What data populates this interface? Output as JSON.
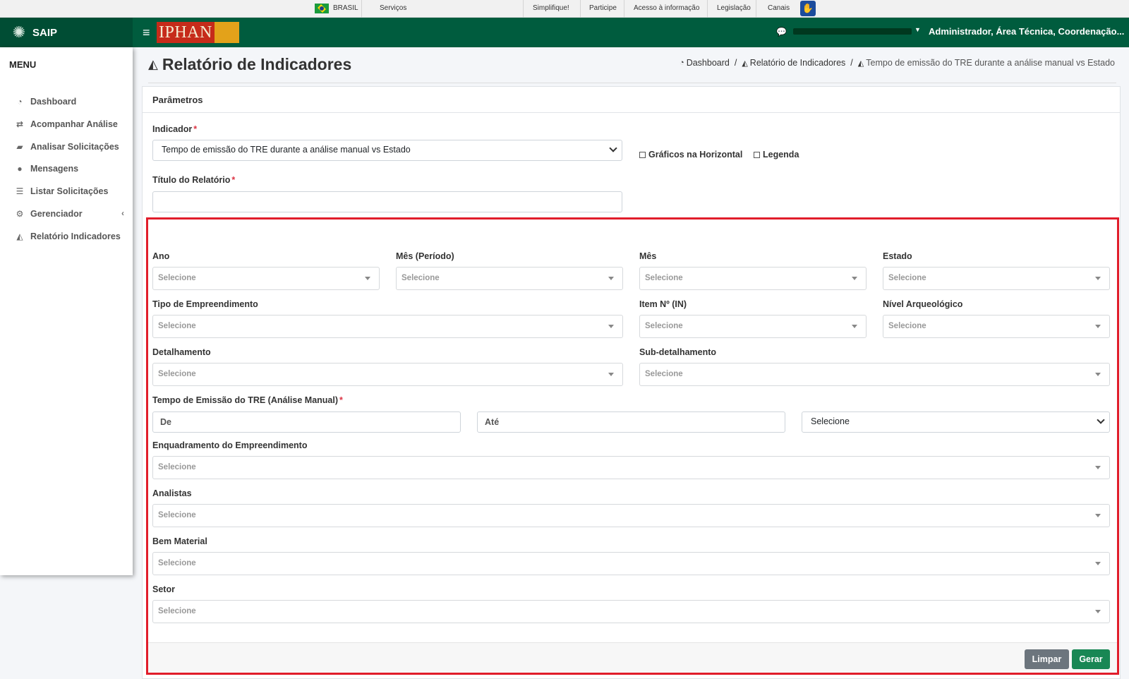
{
  "govbar": {
    "country": "BRASIL",
    "services": "Serviços",
    "links": [
      "Simplifique!",
      "Participe",
      "Acesso à informação",
      "Legislação",
      "Canais"
    ]
  },
  "topbar": {
    "app_name": "SAIP",
    "logo_text": "IPHAN",
    "user_role": "Administrador, Área Técnica, Coordenação..."
  },
  "sidebar": {
    "title": "MENU",
    "items": [
      {
        "label": "Dashboard",
        "icon": "dashboard-icon"
      },
      {
        "label": "Acompanhar Análise",
        "icon": "exchange-icon"
      },
      {
        "label": "Analisar Solicitações",
        "icon": "book-icon"
      },
      {
        "label": "Mensagens",
        "icon": "comments-icon"
      },
      {
        "label": "Listar Solicitações",
        "icon": "list-icon"
      },
      {
        "label": "Gerenciador",
        "icon": "cogs-icon"
      },
      {
        "label": "Relatório Indicadores",
        "icon": "area-chart-icon"
      }
    ]
  },
  "page": {
    "title": "Relatório de Indicadores",
    "breadcrumb": [
      "Dashboard",
      "Relatório de Indicadores",
      "Tempo de emissão do TRE durante a análise manual vs Estado"
    ]
  },
  "form": {
    "card_title": "Parâmetros",
    "indicator_label": "Indicador",
    "indicator_value": "Tempo de emissão do TRE durante a análise manual vs Estado",
    "check_horizontal": "Gráficos na Horizontal",
    "check_legend": "Legenda",
    "report_title_label": "Título do Relatório",
    "report_title_value": "",
    "placeholder": "Selecione",
    "fields": {
      "ano": "Ano",
      "mes_periodo": "Mês (Período)",
      "mes": "Mês",
      "estado": "Estado",
      "tipo_empreendimento": "Tipo de Empreendimento",
      "item_in": "Item Nº (IN)",
      "nivel_arqueologico": "Nível Arqueológico",
      "detalhamento": "Detalhamento",
      "sub_detalhamento": "Sub-detalhamento",
      "tempo_emissao": "Tempo de Emissão do TRE (Análise Manual)",
      "enquadramento": "Enquadramento do Empreendimento",
      "analistas": "Analistas",
      "bem_material": "Bem Material",
      "setor": "Setor"
    },
    "from_placeholder": "De",
    "to_placeholder": "Até",
    "unit_select_value": "Selecione",
    "btn_clear": "Limpar",
    "btn_generate": "Gerar"
  },
  "colors": {
    "brand_green": "#005c3e",
    "highlight_red": "#e11d2b",
    "required_red": "#dc3545",
    "generate_green": "#198754",
    "clear_gray": "#6c757d"
  }
}
